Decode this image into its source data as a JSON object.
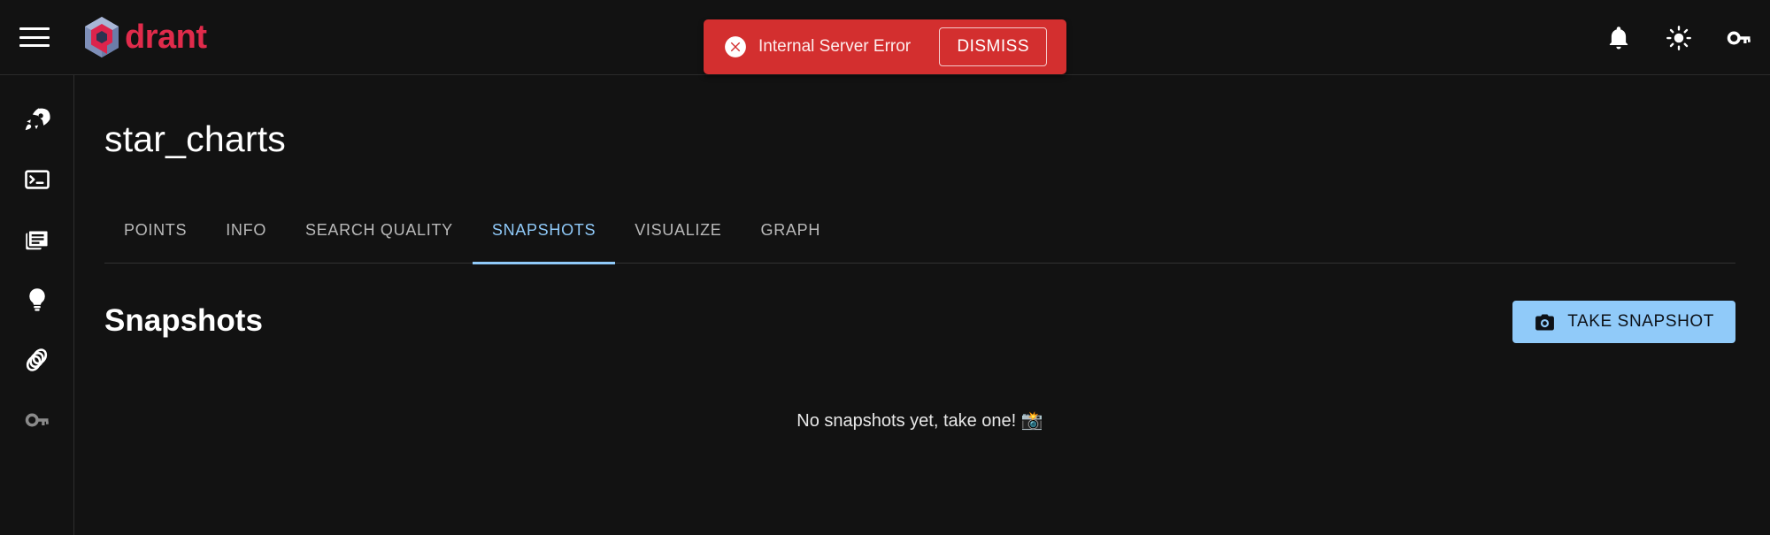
{
  "topbar": {
    "menu_label": "menu",
    "logo_text": "drant",
    "icons": [
      {
        "name": "notifications-icon",
        "label": "Notifications"
      },
      {
        "name": "theme-toggle-icon",
        "label": "Toggle light mode"
      },
      {
        "name": "api-key-icon",
        "label": "API key"
      }
    ]
  },
  "snackbar": {
    "message": "Internal Server Error",
    "dismiss_label": "DISMISS",
    "bg_color": "#d32f2f",
    "text_color": "#fdecec"
  },
  "sidebar": {
    "items": [
      {
        "name": "sidebar-item-welcome",
        "icon": "rocket-icon",
        "label": "Welcome",
        "dimmed": false
      },
      {
        "name": "sidebar-item-console",
        "icon": "console-icon",
        "label": "Console",
        "dimmed": false
      },
      {
        "name": "sidebar-item-collections",
        "icon": "collections-icon",
        "label": "Collections",
        "dimmed": false
      },
      {
        "name": "sidebar-item-tutorial",
        "icon": "lightbulb-icon",
        "label": "Tutorial",
        "dimmed": false
      },
      {
        "name": "sidebar-item-datasets",
        "icon": "datasets-icon",
        "label": "Datasets",
        "dimmed": false
      },
      {
        "name": "sidebar-item-access",
        "icon": "key-icon",
        "label": "Access",
        "dimmed": true
      }
    ]
  },
  "main": {
    "collection_title": "star_charts",
    "tabs": [
      {
        "label": "POINTS",
        "active": false
      },
      {
        "label": "INFO",
        "active": false
      },
      {
        "label": "SEARCH QUALITY",
        "active": false
      },
      {
        "label": "SNAPSHOTS",
        "active": true
      },
      {
        "label": "VISUALIZE",
        "active": false
      },
      {
        "label": "GRAPH",
        "active": false
      }
    ],
    "active_tab_color": "#90caf9",
    "snapshots": {
      "heading": "Snapshots",
      "take_snapshot_label": "TAKE SNAPSHOT",
      "take_snapshot_color": "#90caf9",
      "empty_message": "No snapshots yet, take one! 📸"
    }
  }
}
